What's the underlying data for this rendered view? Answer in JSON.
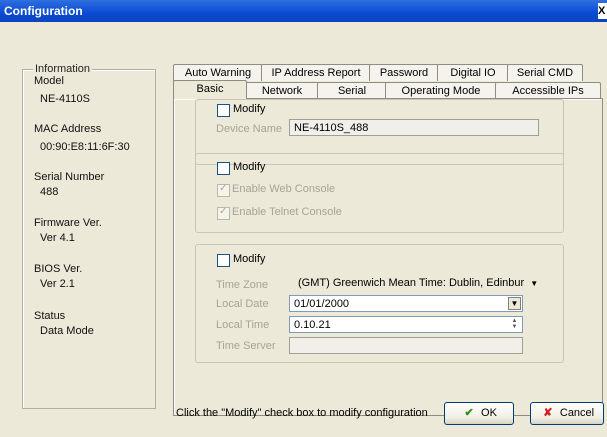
{
  "window": {
    "title": "Configuration"
  },
  "info": {
    "legend": "Information",
    "model_label": "Model",
    "model_value": "NE-4110S",
    "mac_label": "MAC Address",
    "mac_value": "00:90:E8:11:6F:30",
    "serial_label": "Serial Number",
    "serial_value": "488",
    "firmware_label": "Firmware Ver.",
    "firmware_value": "Ver 4.1",
    "bios_label": "BIOS Ver.",
    "bios_value": "Ver 2.1",
    "status_label": "Status",
    "status_value": "Data Mode"
  },
  "tabs": {
    "back_row": [
      "Auto Warning",
      "IP Address Report",
      "Password",
      "Digital IO",
      "Serial CMD"
    ],
    "front_row": [
      "Basic",
      "Network",
      "Serial",
      "Operating Mode",
      "Accessible IPs"
    ],
    "active": "Basic"
  },
  "basic": {
    "device": {
      "modify_label": "Modify",
      "name_label": "Device Name",
      "name_value": "NE-4110S_488"
    },
    "console": {
      "modify_label": "Modify",
      "web_label": "Enable Web Console",
      "telnet_label": "Enable Telnet Console"
    },
    "time": {
      "modify_label": "Modify",
      "timezone_label": "Time Zone",
      "timezone_value": "(GMT) Greenwich Mean Time: Dublin, Edinbur",
      "date_label": "Local Date",
      "date_value": "01/01/2000",
      "time_label": "Local Time",
      "time_value": "0.10.21",
      "server_label": "Time Server",
      "server_value": ""
    }
  },
  "footer": {
    "hint": "Click the \"Modify\" check box to modify configuration",
    "ok_label": "OK",
    "cancel_label": "Cancel"
  },
  "icons": {
    "ok": "check-icon",
    "cancel": "x-icon",
    "accent": "#0a4ad2"
  }
}
